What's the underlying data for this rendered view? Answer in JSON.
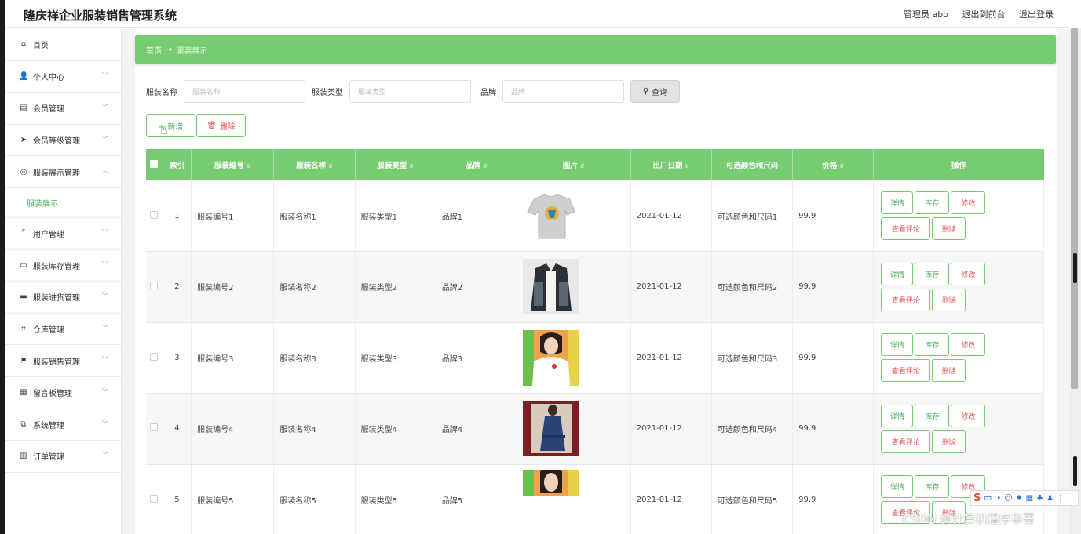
{
  "header": {
    "title": "隆庆祥企业服装销售管理系统",
    "admin_label": "管理员 abo",
    "front_label": "退出到前台",
    "logout_label": "退出登录"
  },
  "sidebar": {
    "items": [
      {
        "label": "首页",
        "icon": "home-icon",
        "glyph": "⌂"
      },
      {
        "label": "个人中心",
        "icon": "user-icon",
        "glyph": "👤"
      },
      {
        "label": "会员管理",
        "icon": "members-icon",
        "glyph": "▤"
      },
      {
        "label": "会员等级管理",
        "icon": "send-icon",
        "glyph": "➤"
      },
      {
        "label": "服装展示管理",
        "icon": "compass-icon",
        "glyph": "◎"
      },
      {
        "label": "用户管理",
        "icon": "crop-icon",
        "glyph": "⌜"
      },
      {
        "label": "服装库存管理",
        "icon": "chat-icon",
        "glyph": "▭"
      },
      {
        "label": "服装进货管理",
        "icon": "print-icon",
        "glyph": "▬"
      },
      {
        "label": "仓库管理",
        "icon": "bracket-icon",
        "glyph": "⌗"
      },
      {
        "label": "服装销售管理",
        "icon": "flag-icon",
        "glyph": "⚑"
      },
      {
        "label": "留言板管理",
        "icon": "board-icon",
        "glyph": "▦"
      },
      {
        "label": "系统管理",
        "icon": "copy-icon",
        "glyph": "⧉"
      },
      {
        "label": "订单管理",
        "icon": "trash-icon",
        "glyph": "▥"
      }
    ],
    "sub_item": "服装展示"
  },
  "breadcrumb": {
    "home": "首页",
    "sep": "→",
    "current": "服装展示"
  },
  "search": {
    "name_label": "服装名称",
    "name_placeholder": "服装名称",
    "type_label": "服装类型",
    "type_placeholder": "服装类型",
    "brand_label": "品牌",
    "brand_placeholder": "品牌",
    "query_label": "查询"
  },
  "actions": {
    "add_label": "+ 新增",
    "delete_label": "删除"
  },
  "table": {
    "headers": [
      "索引",
      "服装编号",
      "服装名称",
      "服装类型",
      "品牌",
      "图片",
      "出厂日期",
      "可选颜色和尺码",
      "价格",
      "操作"
    ],
    "rows": [
      {
        "idx": "1",
        "code": "服装编号1",
        "name": "服装名称1",
        "type": "服装类型1",
        "brand": "品牌1",
        "date": "2021-01-12",
        "color": "可选颜色和尺码1",
        "price": "99.9"
      },
      {
        "idx": "2",
        "code": "服装编号2",
        "name": "服装名称2",
        "type": "服装类型2",
        "brand": "品牌2",
        "date": "2021-01-12",
        "color": "可选颜色和尺码2",
        "price": "99.9"
      },
      {
        "idx": "3",
        "code": "服装编号3",
        "name": "服装名称3",
        "type": "服装类型3",
        "brand": "品牌3",
        "date": "2021-01-12",
        "color": "可选颜色和尺码3",
        "price": "99.9"
      },
      {
        "idx": "4",
        "code": "服装编号4",
        "name": "服装名称4",
        "type": "服装类型4",
        "brand": "品牌4",
        "date": "2021-01-12",
        "color": "可选颜色和尺码4",
        "price": "99.9"
      },
      {
        "idx": "5",
        "code": "服装编号5",
        "name": "服装名称5",
        "type": "服装类型5",
        "brand": "品牌5",
        "date": "2021-01-12",
        "color": "可选颜色和尺码5",
        "price": "99.9"
      }
    ],
    "ops": {
      "detail": "详情",
      "stock": "库存",
      "edit": "修改",
      "review": "查看评论",
      "delete": "删除"
    }
  },
  "watermark": "CSDN @计算机程序华哥",
  "ime": {
    "label": "中"
  },
  "colors": {
    "accent": "#77cc72",
    "danger": "#e05555",
    "accent_text": "#4cae5e"
  }
}
